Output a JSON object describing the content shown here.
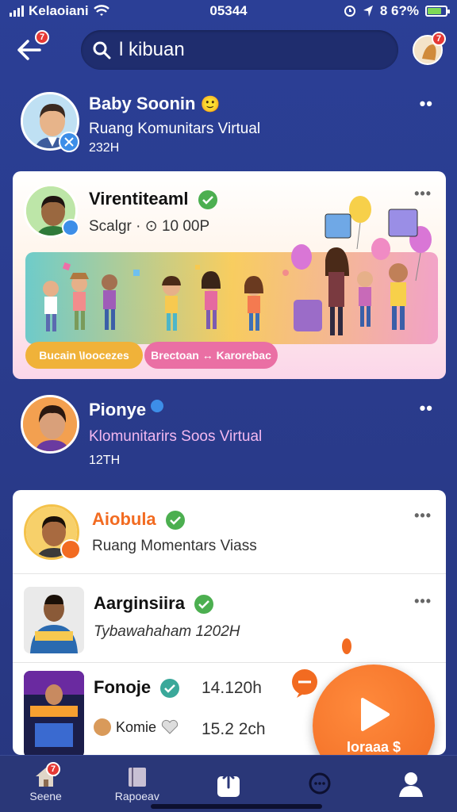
{
  "status": {
    "carrier": "Kelaoiani",
    "time": "05344",
    "battery_text": "8 6?%",
    "battery_level": 0.75
  },
  "header": {
    "back_badge": "7",
    "search_value": "l kibuan",
    "profile_badge": "7"
  },
  "posts": [
    {
      "name": "Baby Soonin",
      "emoji": "🙂",
      "subtitle": "Ruang Komunitars Virtual",
      "time": "232H",
      "menu": "••"
    },
    {
      "name": "Virentiteaml",
      "meta": "Scalgr · ⊙ 10 00P",
      "menu": "•••",
      "pill_left": "Bucain  \\Ioocezes",
      "pill_right": "Brectoan  ↔ Karorebac"
    },
    {
      "name": "Pionye",
      "subtitle": "Klomunitarirs Soos Virtual",
      "time": "12TH",
      "menu": "••"
    }
  ],
  "list": [
    {
      "name": "Aiobula",
      "subtitle": "Ruang Momentars Viass",
      "menu": "•••"
    },
    {
      "name": "Aarginsiira",
      "subtitle": "Tybawahaham 1202H",
      "menu": "•••"
    },
    {
      "name": "Fonoje",
      "time": "14.120h",
      "sub_name": "Komie",
      "sub_time": "15.2 2ch"
    }
  ],
  "fab": {
    "label": "Ioraaa $"
  },
  "nav": [
    {
      "label": "Seene",
      "badge": "7"
    },
    {
      "label": "Rapoeav"
    },
    {
      "label": ""
    },
    {
      "label": ""
    },
    {
      "label": ""
    }
  ],
  "colors": {
    "background": "#2b3f96",
    "accent_orange": "#f26b21",
    "verified_green": "#4caf50",
    "badge_red": "#e53935"
  }
}
